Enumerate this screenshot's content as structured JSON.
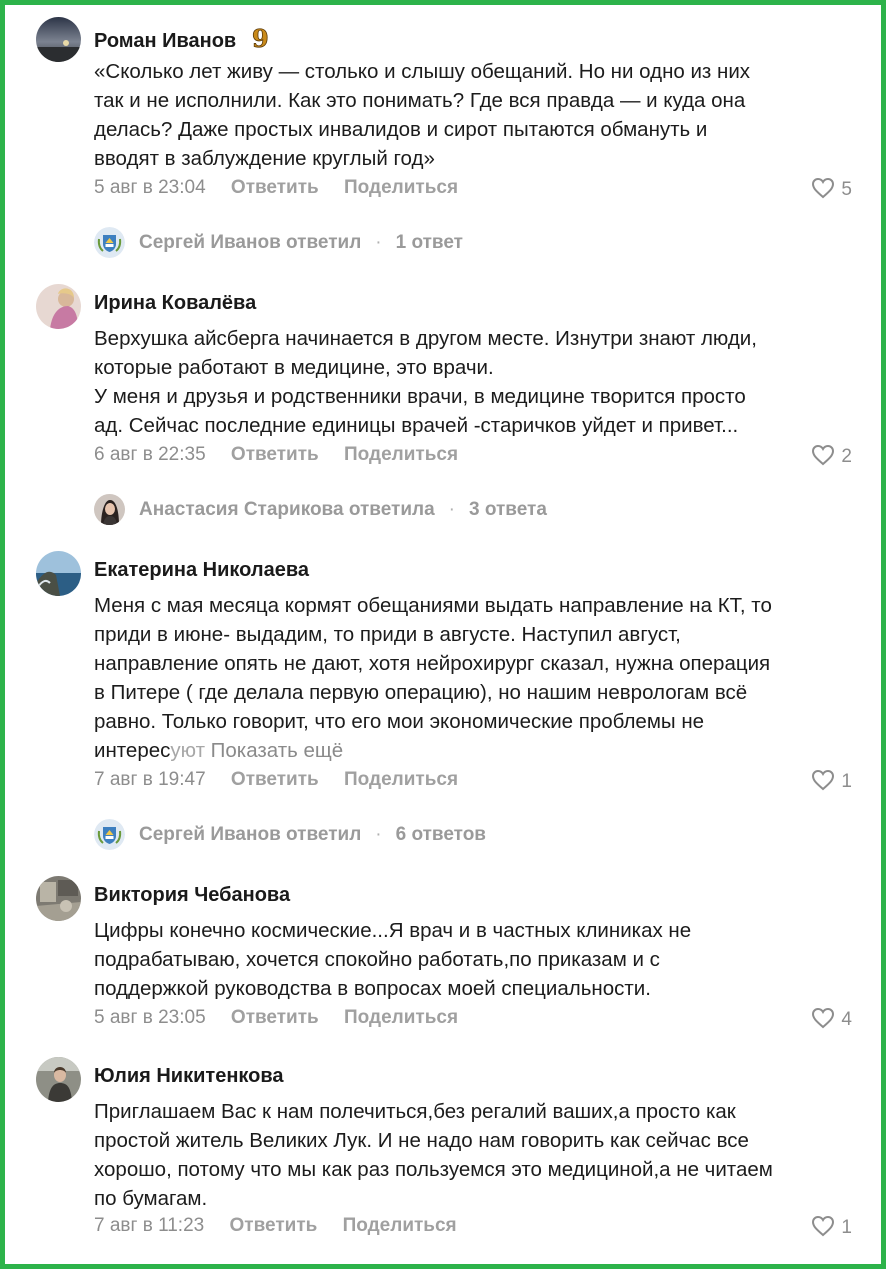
{
  "colors": {
    "frame": "#2db34a",
    "meta": "#8d8d8d",
    "text": "#1c1c1c"
  },
  "comments": [
    {
      "author": "Роман Иванов",
      "badge_icon": "level-badge-icon",
      "badge": "9",
      "lines": [
        "«Сколько лет живу — столько и слышу обещаний. Но ни одно из них",
        "так и не исполнили. Как это понимать? Где вся правда — и куда она",
        "делась? Даже простых инвалидов и сирот пытаются обмануть и",
        "вводят в заблуждение круглый год»"
      ],
      "date": "5 авг в 23:04",
      "reply_label": "Ответить",
      "share_label": "Поделиться",
      "likes": "5",
      "thread": {
        "name": "Сергей Иванов ответил",
        "count": "1 ответ",
        "avatar_icon": "coat-of-arms-icon"
      }
    },
    {
      "author": "Ирина Ковалёва",
      "lines": [
        "Верхушка айсберга начинается в другом месте. Изнутри знают люди,",
        "которые работают в медицине, это врачи.",
        "У меня и друзья и родственники врачи, в медицине творится просто",
        "ад. Сейчас последние единицы врачей -старичков уйдет и привет..."
      ],
      "date": "6 авг в 22:35",
      "reply_label": "Ответить",
      "share_label": "Поделиться",
      "likes": "2",
      "thread": {
        "name": "Анастасия Старикова ответила",
        "count": "3 ответа",
        "avatar_icon": "user-photo-icon"
      }
    },
    {
      "author": "Екатерина Николаева",
      "lines": [
        "Меня с мая месяца кормят обещаниями выдать направление на КТ, то",
        "приди в июне- выдадим, то приди в августе. Наступил август,",
        "направление опять не дают, хотя нейрохирург сказал, нужна операция",
        "в Питере ( где делала первую операцию), но нашим неврологам всё",
        "равно. Только говорит, что его мои экономические проблемы не"
      ],
      "last_line_start": "интерес",
      "last_line_fade": "уют",
      "show_more": "Показать ещё",
      "date": "7 авг в 19:47",
      "reply_label": "Ответить",
      "share_label": "Поделиться",
      "likes": "1",
      "thread": {
        "name": "Сергей Иванов ответил",
        "count": "6 ответов",
        "avatar_icon": "coat-of-arms-icon"
      }
    },
    {
      "author": "Виктория Чебанова",
      "lines": [
        "Цифры конечно космические...Я врач и в частных клиниках не",
        "подрабатываю, хочется спокойно работать,по приказам и с",
        "поддержкой руководства в вопросах моей специальности."
      ],
      "date": "5 авг в 23:05",
      "reply_label": "Ответить",
      "share_label": "Поделиться",
      "likes": "4"
    },
    {
      "author": "Юлия Никитенкова",
      "lines": [
        "Приглашаем Вас к нам полечиться,без регалий ваших,а просто как",
        "простой житель Великих Лук. И не надо нам говорить как сейчас все",
        "хорошо, потому что мы как раз пользуемся это медициной,а не читаем",
        "по бумагам."
      ],
      "date": "7 авг в 11:23",
      "reply_label": "Ответить",
      "share_label": "Поделиться",
      "likes": "1"
    }
  ]
}
